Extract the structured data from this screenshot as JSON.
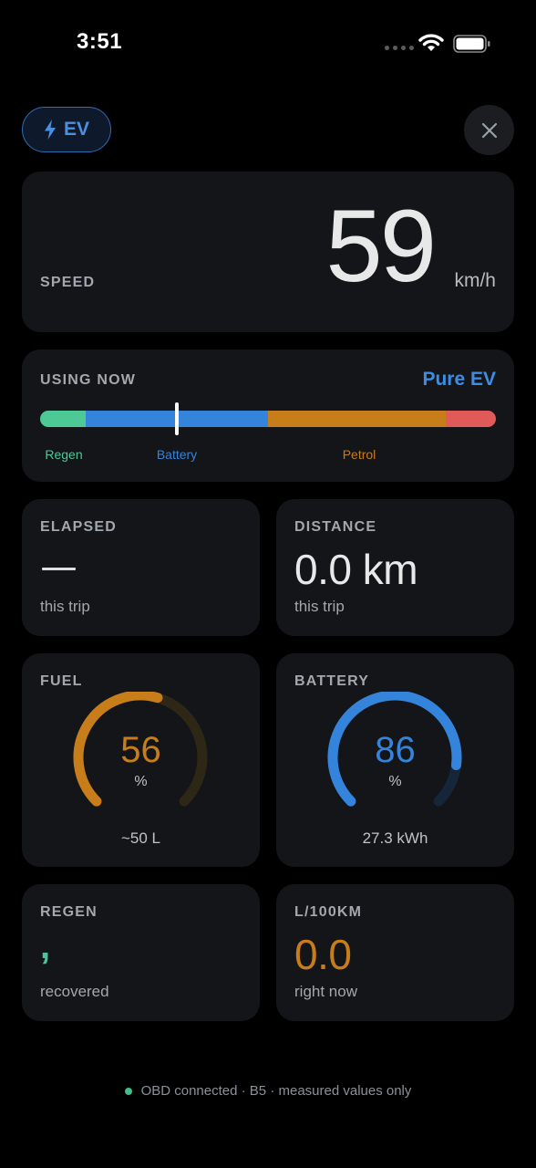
{
  "status_bar": {
    "time": "3:51"
  },
  "header": {
    "mode_badge": "EV",
    "close_icon": "close-icon"
  },
  "speed": {
    "caption": "SPEED",
    "value": "59",
    "unit": "km/h"
  },
  "using_now": {
    "caption": "USING NOW",
    "mode": "Pure EV",
    "segments": [
      {
        "name": "Regen",
        "fraction": 0.1,
        "color": "#4cc995"
      },
      {
        "name": "Battery",
        "fraction": 0.4,
        "color": "#3584db"
      },
      {
        "name": "Petrol",
        "fraction": 0.39,
        "color": "#c77d1a"
      },
      {
        "name": "",
        "fraction": 0.11,
        "color": "#e15a5a"
      }
    ],
    "marker_fraction": 0.3,
    "labels": {
      "regen": "Regen",
      "battery": "Battery",
      "petrol": "Petrol"
    },
    "colors": {
      "regen": "#4cc995",
      "battery": "#3584db",
      "petrol": "#c77d1a",
      "mode": "#3b8de6"
    }
  },
  "elapsed": {
    "caption": "ELAPSED",
    "value": "—",
    "sub": "this trip"
  },
  "distance": {
    "caption": "DISTANCE",
    "value": "0.0 km",
    "sub": "this trip"
  },
  "fuel": {
    "caption": "FUEL",
    "value": "56",
    "unit": "%",
    "sub": "~50 L",
    "level": 0.56,
    "color": "#c77d1a",
    "track_color": "#2e2716"
  },
  "battery": {
    "caption": "BATTERY",
    "value": "86",
    "unit": "%",
    "sub": "27.3 kWh",
    "level": 0.86,
    "color": "#3584db",
    "track_color": "#15263b"
  },
  "regen": {
    "caption": "REGEN",
    "value": ",",
    "sub": "recovered"
  },
  "consumption": {
    "caption": "L/100KM",
    "value": "0.0",
    "sub": "right now",
    "color": "#c77d1a"
  },
  "footer": {
    "status": "OBD connected · B5 · measured values only"
  }
}
